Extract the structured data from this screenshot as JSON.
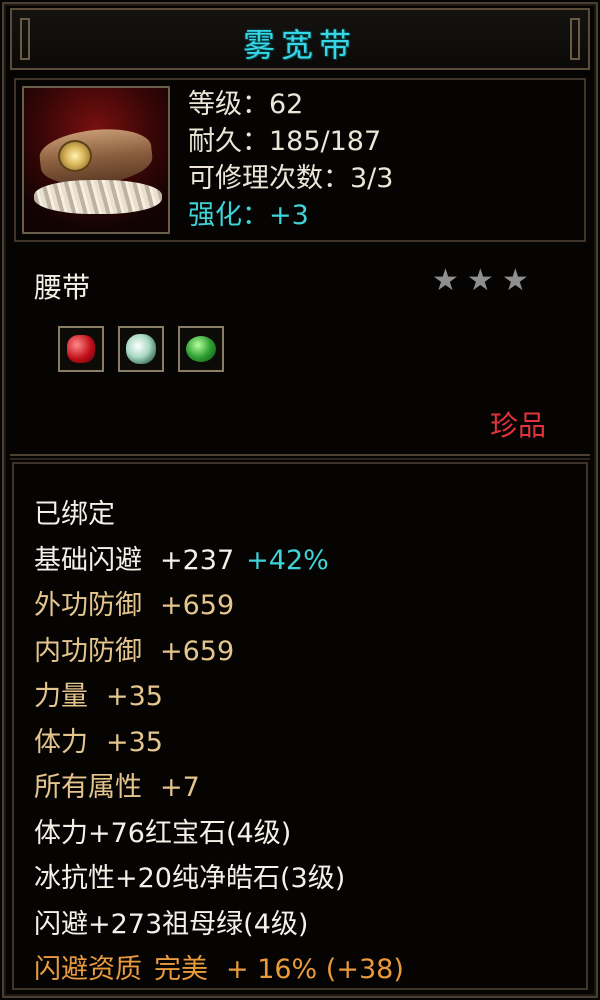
{
  "item": {
    "title": "雾宽带",
    "stats": {
      "level_label": "等级：",
      "level": "62",
      "durability_label": "耐久：",
      "durability": "185/187",
      "repair_label": "可修理次数：",
      "repair": "3/3",
      "enhance_label": "强化：",
      "enhance": "+3"
    },
    "type": "腰带",
    "stars": [
      "★",
      "★",
      "★"
    ],
    "gems": [
      "ruby-gem-icon",
      "diamond-gem-icon",
      "emerald-gem-icon"
    ],
    "rarity": "珍品"
  },
  "attributes": {
    "bound": "已绑定",
    "base_dodge_label": "基础闪避",
    "base_dodge_value": "+237",
    "base_dodge_bonus": "+42%",
    "outer_def_label": "外功防御",
    "outer_def_value": "+659",
    "inner_def_label": "内功防御",
    "inner_def_value": "+659",
    "strength_label": "力量",
    "strength_value": "+35",
    "stamina_label": "体力",
    "stamina_value": "+35",
    "all_attr_label": "所有属性",
    "all_attr_value": "+7",
    "gem1": "体力+76红宝石(4级)",
    "gem2": "冰抗性+20纯净皓石(3级)",
    "gem3": "闪避+273祖母绿(4级)",
    "quality_label": "闪避资质",
    "quality_grade": "完美",
    "quality_value": "+ 16% (+38)"
  },
  "colors": {
    "title": "#38d6e6",
    "enhance": "#3fd3d8",
    "rarity": "#e2333b",
    "gold_text": "#e5c58e",
    "quality": "#e99a3d"
  }
}
